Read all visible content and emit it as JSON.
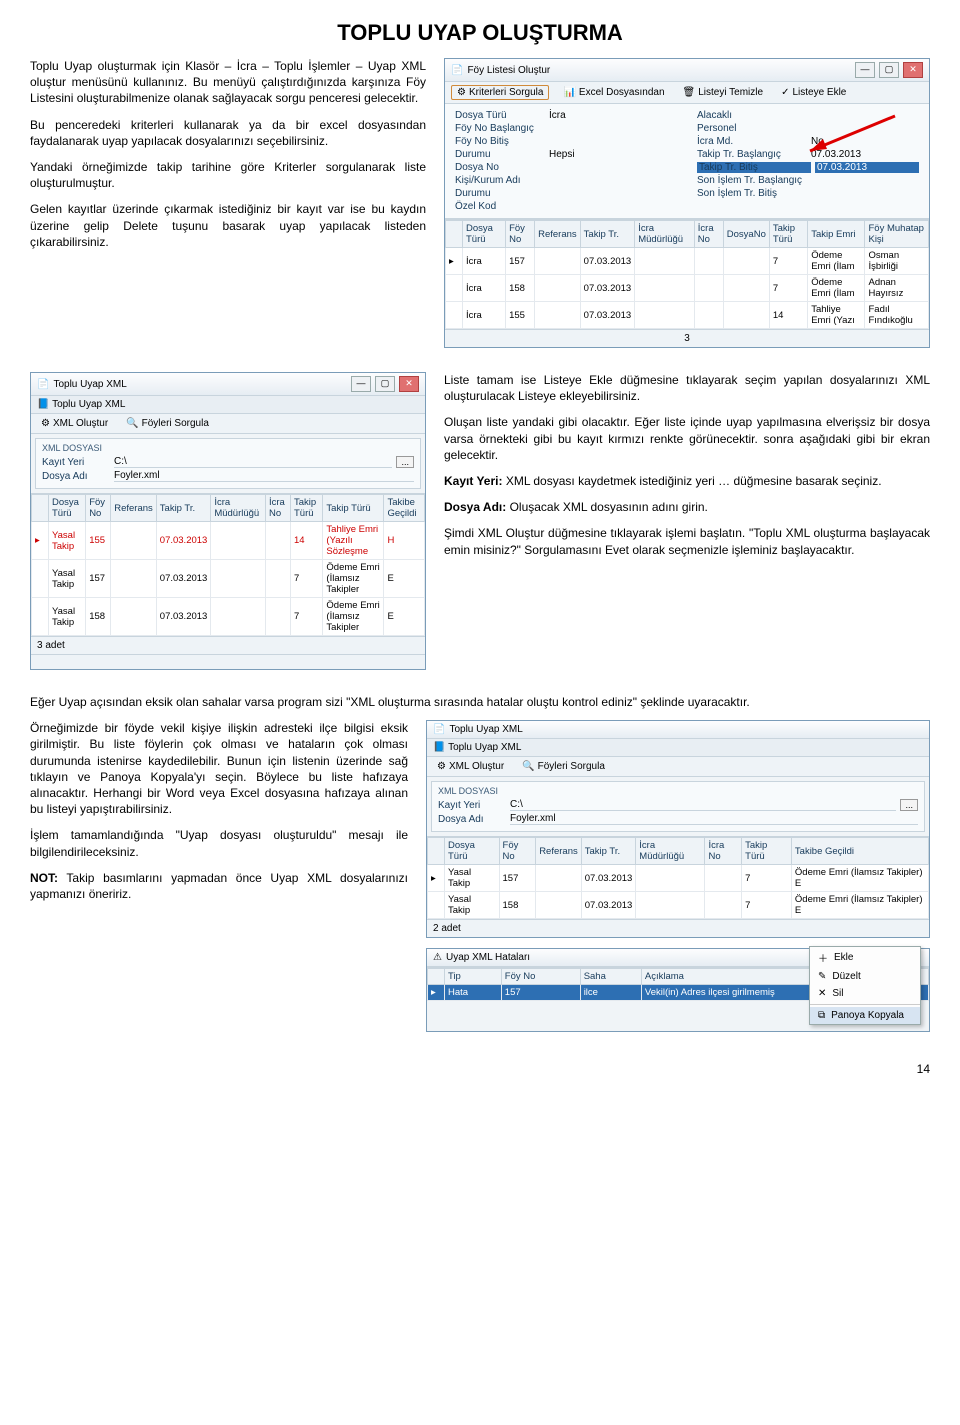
{
  "title": "TOPLU UYAP OLUŞTURMA",
  "p1": "Toplu Uyap oluşturmak için Klasör – İcra – Toplu İşlemler – Uyap XML oluştur menüsünü kullanınız. Bu menüyü çalıştırdığınızda karşınıza Föy Listesini oluşturabilmenize olanak sağlayacak sorgu penceresi gelecektir.",
  "p2": "Bu penceredeki kriterleri kullanarak ya da bir excel dosyasından faydalanarak uyap yapılacak dosyalarınızı seçebilirsiniz.",
  "p3": "Yandaki örneğimizde takip tarihine göre Kriterler sorgulanarak liste oluşturulmuştur.",
  "p4": "Gelen kayıtlar üzerinde çıkarmak istediğiniz bir kayıt var ise bu kaydın üzerine gelip Delete tuşunu basarak uyap yapılacak listeden çıkarabilirsiniz.",
  "foy": {
    "title": "Föy Listesi Oluştur",
    "toolbar": {
      "kriter": "Kriterleri Sorgula",
      "excel": "Excel Dosyasından",
      "temizle": "Listeyi Temizle",
      "ekle": "Listeye Ekle"
    },
    "form": {
      "l1": "Dosya Türü",
      "v1": "İcra",
      "l2": "Föy No Başlangıç",
      "l3": "Föy No Bitiş",
      "l4": "Durumu",
      "v4": "Hepsi",
      "l5": "Dosya No",
      "l6": "Kişi/Kurum Adı",
      "l7": "Durumu",
      "l8": "Özel Kod",
      "r1": "Alacaklı",
      "r2": "Personel",
      "r3": "İcra Md.",
      "r3v": "No",
      "r4": "Takip Tr. Başlangıç",
      "r4v": "07.03.2013",
      "r5": "Takip Tr. Bitiş",
      "r5v": "07.03.2013",
      "r6": "Son İşlem Tr. Başlangıç",
      "r7": "Son İşlem Tr. Bitiş"
    },
    "cols": [
      "Dosya Türü",
      "Föy No",
      "Referans",
      "Takip Tr.",
      "İcra Müdürlüğü",
      "İcra No",
      "DosyaNo",
      "Takip Türü",
      "Takip Emri",
      "Föy Muhatap Kişi"
    ],
    "rows": [
      [
        "İcra",
        "157",
        "",
        "07.03.2013",
        "",
        "",
        "",
        "7",
        "Ödeme Emri (İlam",
        "Osman İşbirliği"
      ],
      [
        "İcra",
        "158",
        "",
        "07.03.2013",
        "",
        "",
        "",
        "7",
        "Ödeme Emri (İlam",
        "Adnan Hayırsız"
      ],
      [
        "İcra",
        "155",
        "",
        "07.03.2013",
        "",
        "",
        "",
        "14",
        "Tahliye Emri (Yazı",
        "Fadıl Fındıkoğlu"
      ]
    ],
    "count": "3"
  },
  "topluxml1": {
    "title": "Toplu Uyap XML",
    "sub": "Toplu Uyap XML",
    "toolbar": {
      "olustur": "XML Oluştur",
      "sorgula": "Föyleri Sorgula"
    },
    "group": "XML DOSYASI",
    "kayit_l": "Kayıt Yeri",
    "kayit_v": "C:\\",
    "dosya_l": "Dosya Adı",
    "dosya_v": "Foyler.xml",
    "cols": [
      "Dosya Türü",
      "Föy No",
      "Referans",
      "Takip Tr.",
      "İcra Müdürlüğü",
      "İcra No",
      "Takip Türü",
      "Takip Türü",
      "Takibe Geçildi"
    ],
    "rows": [
      [
        "Yasal Takip",
        "155",
        "",
        "07.03.2013",
        "",
        "",
        "14",
        "Tahliye Emri (Yazılı Sözleşme",
        "H"
      ],
      [
        "Yasal Takip",
        "157",
        "",
        "07.03.2013",
        "",
        "",
        "7",
        "Ödeme Emri (İlamsız Takipler",
        "E"
      ],
      [
        "Yasal Takip",
        "158",
        "",
        "07.03.2013",
        "",
        "",
        "7",
        "Ödeme Emri (İlamsız Takipler",
        "E"
      ]
    ],
    "count": "3 adet"
  },
  "r1": "Liste tamam ise Listeye Ekle düğmesine tıklayarak seçim yapılan dosyalarınızı XML oluşturulacak Listeye ekleyebilirsiniz.",
  "r2": "Oluşan liste yandaki gibi olacaktır. Eğer liste içinde uyap yapılmasına elverişsiz bir dosya varsa örnekteki gibi bu kayıt kırmızı renkte görünecektir. sonra aşağıdaki gibi bir ekran gelecektir.",
  "r3a": "Kayıt Yeri:",
  "r3b": " XML dosyası kaydetmek istediğiniz yeri … düğmesine basarak seçiniz.",
  "r4a": "Dosya Adı:",
  "r4b": " Oluşacak XML dosyasının adını girin.",
  "r5": "Şimdi XML Oluştur düğmesine tıklayarak işlemi başlatın. \"Toplu XML oluşturma başlayacak emin misiniz?\" Sorgulamasını Evet olarak seçmenizle işleminiz başlayacaktır.",
  "p5": "Eğer Uyap açısından eksik olan sahalar varsa program sizi \"XML oluşturma sırasında hatalar oluştu kontrol ediniz\" şeklinde uyaracaktır.",
  "p6": "Örneğimizde bir föyde vekil kişiye ilişkin adresteki ilçe bilgisi eksik girilmiştir. Bu liste föylerin çok olması ve hataların çok olması durumunda istenirse kaydedilebilir. Bunun için listenin üzerinde sağ tıklayın ve Panoya Kopyala'yı seçin. Böylece bu liste hafızaya alınacaktır. Herhangi bir Word veya Excel dosyasına hafızaya alınan bu listeyi yapıştırabilirsiniz.",
  "p7": "İşlem tamamlandığında \"Uyap dosyası oluşturuldu\" mesajı ile bilgilendirileceksiniz.",
  "p8a": "NOT:",
  "p8b": " Takip basımlarını yapmadan önce Uyap XML dosyalarınızı yapmanızı öneririz.",
  "topluxml2": {
    "title": "Toplu Uyap XML",
    "sub": "Toplu Uyap XML",
    "toolbar": {
      "olustur": "XML Oluştur",
      "sorgula": "Föyleri Sorgula"
    },
    "group": "XML DOSYASI",
    "kayit_l": "Kayıt Yeri",
    "kayit_v": "C:\\",
    "dosya_l": "Dosya Adı",
    "dosya_v": "Foyler.xml",
    "cols": [
      "Dosya Türü",
      "Föy No",
      "Referans",
      "Takip Tr.",
      "İcra Müdürlüğü",
      "İcra No",
      "Takip Türü",
      "Takibe Geçildi"
    ],
    "rows": [
      [
        "Yasal Takip",
        "157",
        "",
        "07.03.2013",
        "",
        "",
        "7",
        "Ödeme Emri (İlamsız Takipler) E"
      ],
      [
        "Yasal Takip",
        "158",
        "",
        "07.03.2013",
        "",
        "",
        "7",
        "Ödeme Emri (İlamsız Takipler) E"
      ]
    ],
    "count": "2 adet"
  },
  "hatalar": {
    "title": "Uyap XML Hataları",
    "cols": [
      "Tip",
      "Föy No",
      "Saha",
      "Açıklama"
    ],
    "row": [
      "Hata",
      "157",
      "ilce",
      "Vekil(in) Adres ilçesi girilmemiş"
    ]
  },
  "ctx": {
    "ekle": "Ekle",
    "duzelt": "Düzelt",
    "sil": "Sil",
    "panoya": "Panoya Kopyala"
  },
  "pagenum": "14"
}
